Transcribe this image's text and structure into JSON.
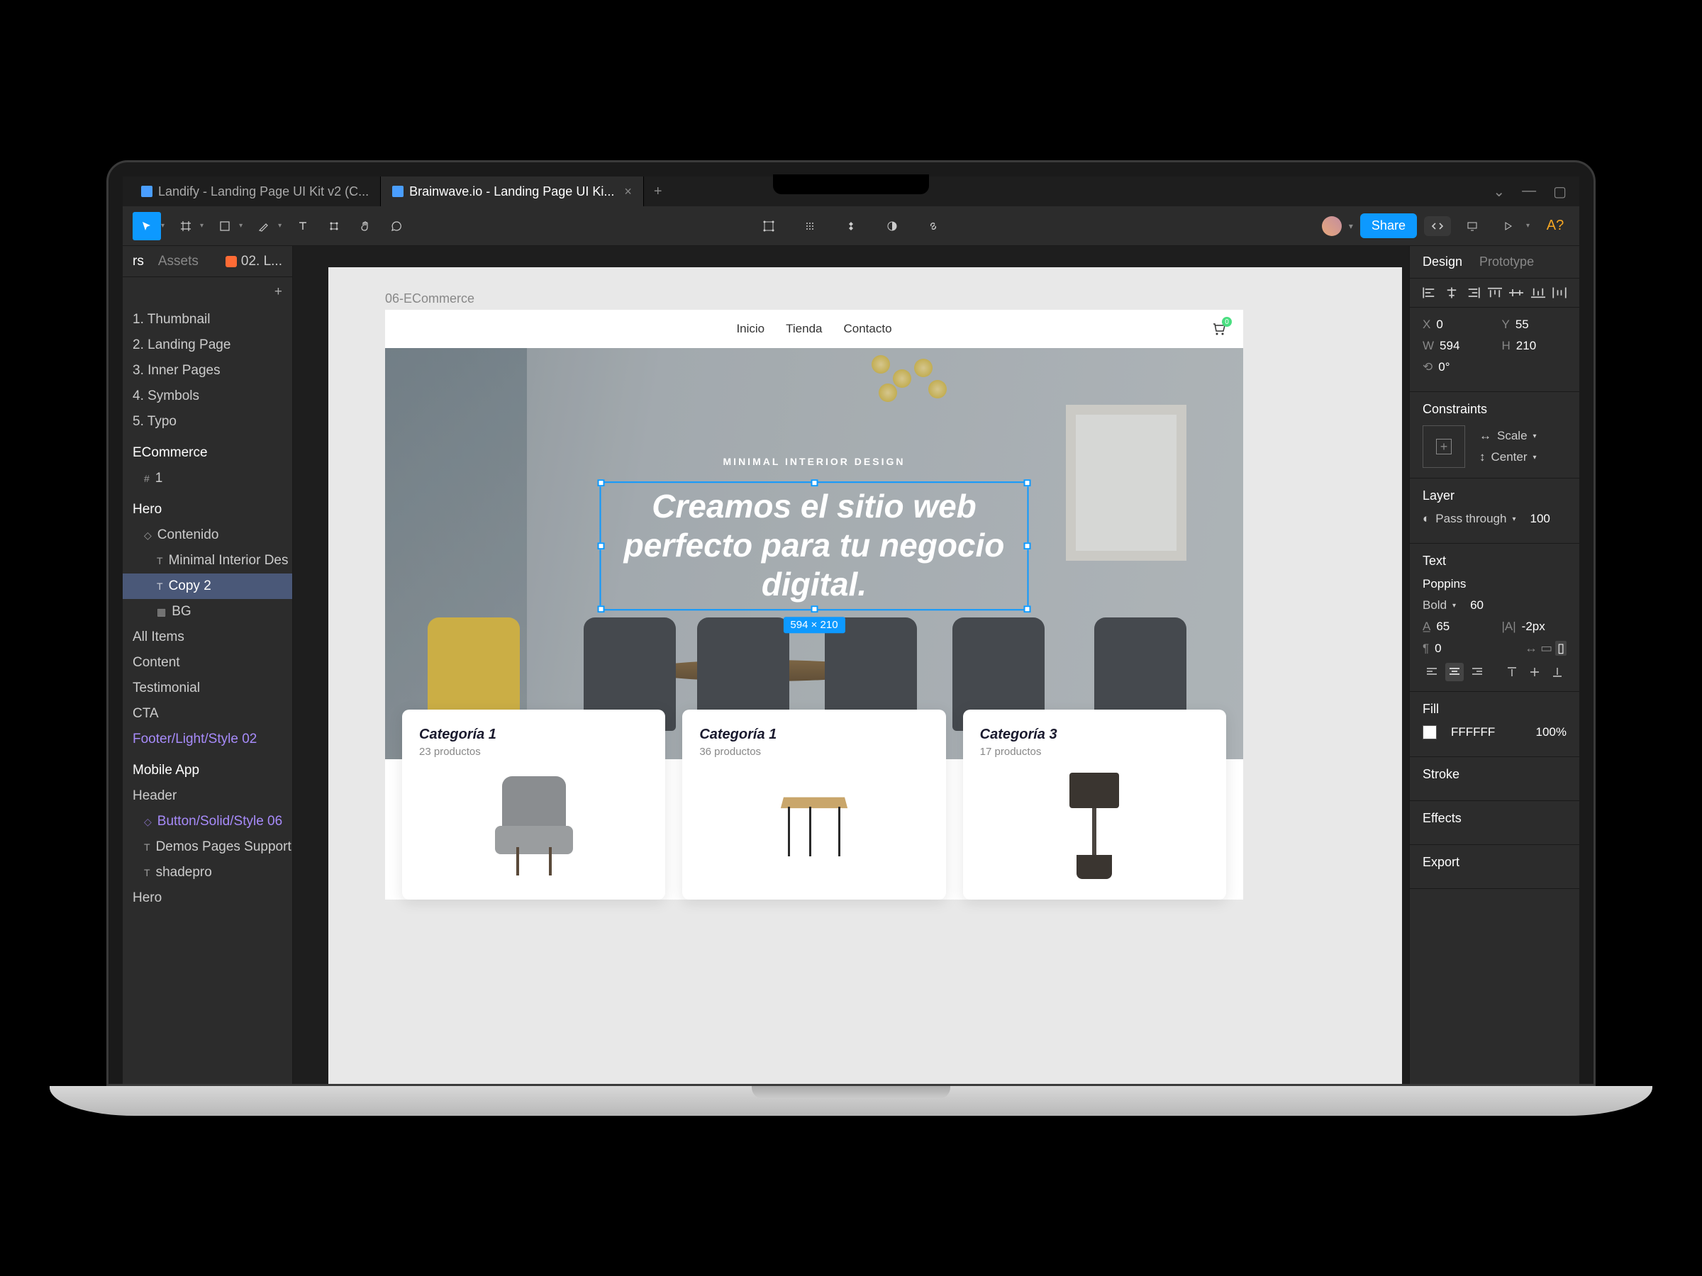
{
  "tabs": [
    {
      "label": "Landify - Landing Page UI Kit v2 (C..."
    },
    {
      "label": "Brainwave.io - Landing Page UI Ki..."
    }
  ],
  "toolbar": {
    "share_label": "Share"
  },
  "left_panel": {
    "tabs": {
      "layers": "rs",
      "assets": "Assets"
    },
    "file": "02. L...",
    "pages": [
      "1. Thumbnail",
      "2. Landing Page",
      "3. Inner Pages",
      "4. Symbols",
      "5. Typo"
    ],
    "section": "ECommerce",
    "layers": [
      {
        "label": "1",
        "indent": 1,
        "icon": "frame"
      },
      {
        "label": "Hero",
        "indent": 0,
        "heading": true
      },
      {
        "label": "Contenido",
        "indent": 1,
        "icon": "component"
      },
      {
        "label": "Minimal Interior Des",
        "indent": 2,
        "icon": "text"
      },
      {
        "label": "Copy 2",
        "indent": 2,
        "icon": "text",
        "selected": true
      },
      {
        "label": "BG",
        "indent": 2,
        "icon": "image"
      },
      {
        "label": "All Items",
        "indent": 0
      },
      {
        "label": "Content",
        "indent": 0
      },
      {
        "label": "Testimonial",
        "indent": 0
      },
      {
        "label": "CTA",
        "indent": 0
      },
      {
        "label": "Footer/Light/Style 02",
        "indent": 0,
        "purple": true
      },
      {
        "label": "Mobile App",
        "indent": 0,
        "heading": true
      },
      {
        "label": "Header",
        "indent": 0
      },
      {
        "label": "Button/Solid/Style 06",
        "indent": 1,
        "icon": "component",
        "purple": true
      },
      {
        "label": "Demos Pages Support",
        "indent": 1,
        "icon": "text"
      },
      {
        "label": "shadepro",
        "indent": 1,
        "icon": "text"
      },
      {
        "label": "Hero",
        "indent": 0
      }
    ]
  },
  "canvas": {
    "frame_label": "06-ECommerce",
    "site_nav": [
      "Inicio",
      "Tienda",
      "Contacto"
    ],
    "cart_count": "0",
    "hero_eyebrow": "MINIMAL INTERIOR DESIGN",
    "hero_title": "Creamos el sitio web perfecto para tu negocio digital.",
    "selection_dims": "594 × 210",
    "categories": [
      {
        "title": "Categoría 1",
        "count": "23 productos"
      },
      {
        "title": "Categoría 1",
        "count": "36 productos"
      },
      {
        "title": "Categoría 3",
        "count": "17 productos"
      }
    ]
  },
  "right_panel": {
    "tabs": {
      "design": "Design",
      "prototype": "Prototype"
    },
    "position": {
      "x_label": "X",
      "x": "0",
      "y_label": "Y",
      "y": "55"
    },
    "size": {
      "w_label": "W",
      "w": "594",
      "h_label": "H",
      "h": "210"
    },
    "rotation": {
      "label": "⟲",
      "value": "0°"
    },
    "constraints": {
      "title": "Constraints",
      "horizontal": "Scale",
      "vertical": "Center"
    },
    "layer": {
      "title": "Layer",
      "blend": "Pass through",
      "opacity": "100"
    },
    "text": {
      "title": "Text",
      "font": "Poppins",
      "weight": "Bold",
      "size": "60",
      "line_height": "65",
      "letter_spacing": "-2px",
      "paragraph": "0"
    },
    "fill": {
      "title": "Fill",
      "hex": "FFFFFF",
      "opacity": "100%"
    },
    "stroke_title": "Stroke",
    "effects_title": "Effects",
    "export_title": "Export"
  }
}
